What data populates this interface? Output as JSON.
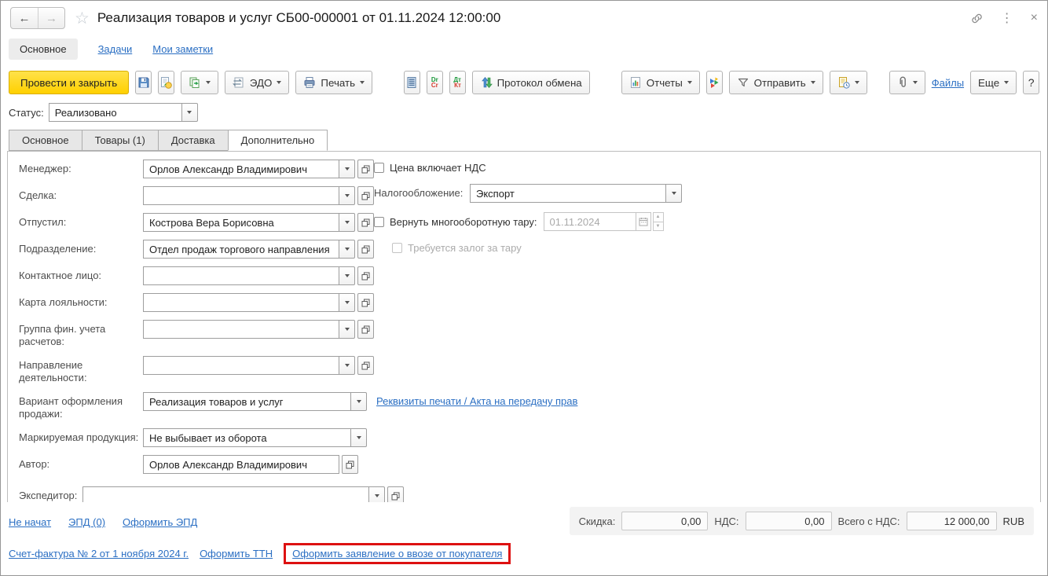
{
  "header": {
    "back_icon": "←",
    "forward_icon": "→",
    "star_icon": "☆",
    "menu_icon": "⋮",
    "close_icon": "×",
    "title": "Реализация товаров и услуг СБ00-000001 от 01.11.2024 12:00:00",
    "nav": [
      {
        "label": "Основное"
      },
      {
        "label": "Задачи"
      },
      {
        "label": "Мои заметки"
      }
    ]
  },
  "toolbar": {
    "post_and_close": "Провести и закрыть",
    "edo": "ЭДО",
    "print": "Печать",
    "drcr_top": "Dr",
    "drcr_bottom": "Cr",
    "dtkt_top": "Дт",
    "dtkt_bottom": "Кт",
    "protocol": "Протокол обмена",
    "reports": "Отчеты",
    "send": "Отправить",
    "files": "Файлы",
    "more": "Еще",
    "help": "?"
  },
  "status": {
    "label": "Статус:",
    "value": "Реализовано"
  },
  "tabs": [
    {
      "label": "Основное"
    },
    {
      "label": "Товары (1)"
    },
    {
      "label": "Доставка"
    },
    {
      "label": "Дополнительно"
    }
  ],
  "form": {
    "manager": {
      "label": "Менеджер:",
      "value": "Орлов Александр Владимирович"
    },
    "deal": {
      "label": "Сделка:",
      "value": ""
    },
    "released_by": {
      "label": "Отпустил:",
      "value": "Кострова Вера Борисовна"
    },
    "department": {
      "label": "Подразделение:",
      "value": "Отдел продаж торгового направления"
    },
    "contact_person": {
      "label": "Контактное лицо:",
      "value": ""
    },
    "loyalty_card": {
      "label": "Карта лояльности:",
      "value": ""
    },
    "fin_group": {
      "label": "Группа фин. учета расчетов:",
      "value": ""
    },
    "business_line": {
      "label": "Направление деятельности:",
      "value": ""
    },
    "sale_option": {
      "label": "Вариант оформления продажи:",
      "value": "Реализация товаров и услуг"
    },
    "marked_products": {
      "label": "Маркируемая продукция:",
      "value": "Не выбывает из оборота"
    },
    "author": {
      "label": "Автор:",
      "value": "Орлов Александр Владимирович"
    },
    "forwarder": {
      "label": "Экспедитор:",
      "value": ""
    },
    "price_includes_vat": "Цена включает НДС",
    "taxation": {
      "label": "Налогообложение:",
      "value": "Экспорт"
    },
    "return_container": {
      "label": "Вернуть многооборотную тару:",
      "date": "01.11.2024"
    },
    "container_deposit": "Требуется залог за тару",
    "print_details_link": "Реквизиты печати / Акта на передачу прав"
  },
  "footer": {
    "epd_status": "Не начат",
    "epd_count": "ЭПД (0)",
    "epd_create": "Оформить ЭПД",
    "totals": {
      "discount_label": "Скидка:",
      "discount": "0,00",
      "vat_label": "НДС:",
      "vat": "0,00",
      "total_label": "Всего с НДС:",
      "total": "12 000,00",
      "currency": "RUB"
    },
    "invoice_link": "Счет-фактура № 2 от 1 ноября 2024 г.",
    "ttn_link": "Оформить ТТН",
    "import_link": "Оформить заявление о ввозе от покупателя"
  },
  "colors": {
    "accent_yellow": "#ffd000",
    "link_blue": "#2b6fc3",
    "highlight_red": "#dd1111"
  }
}
